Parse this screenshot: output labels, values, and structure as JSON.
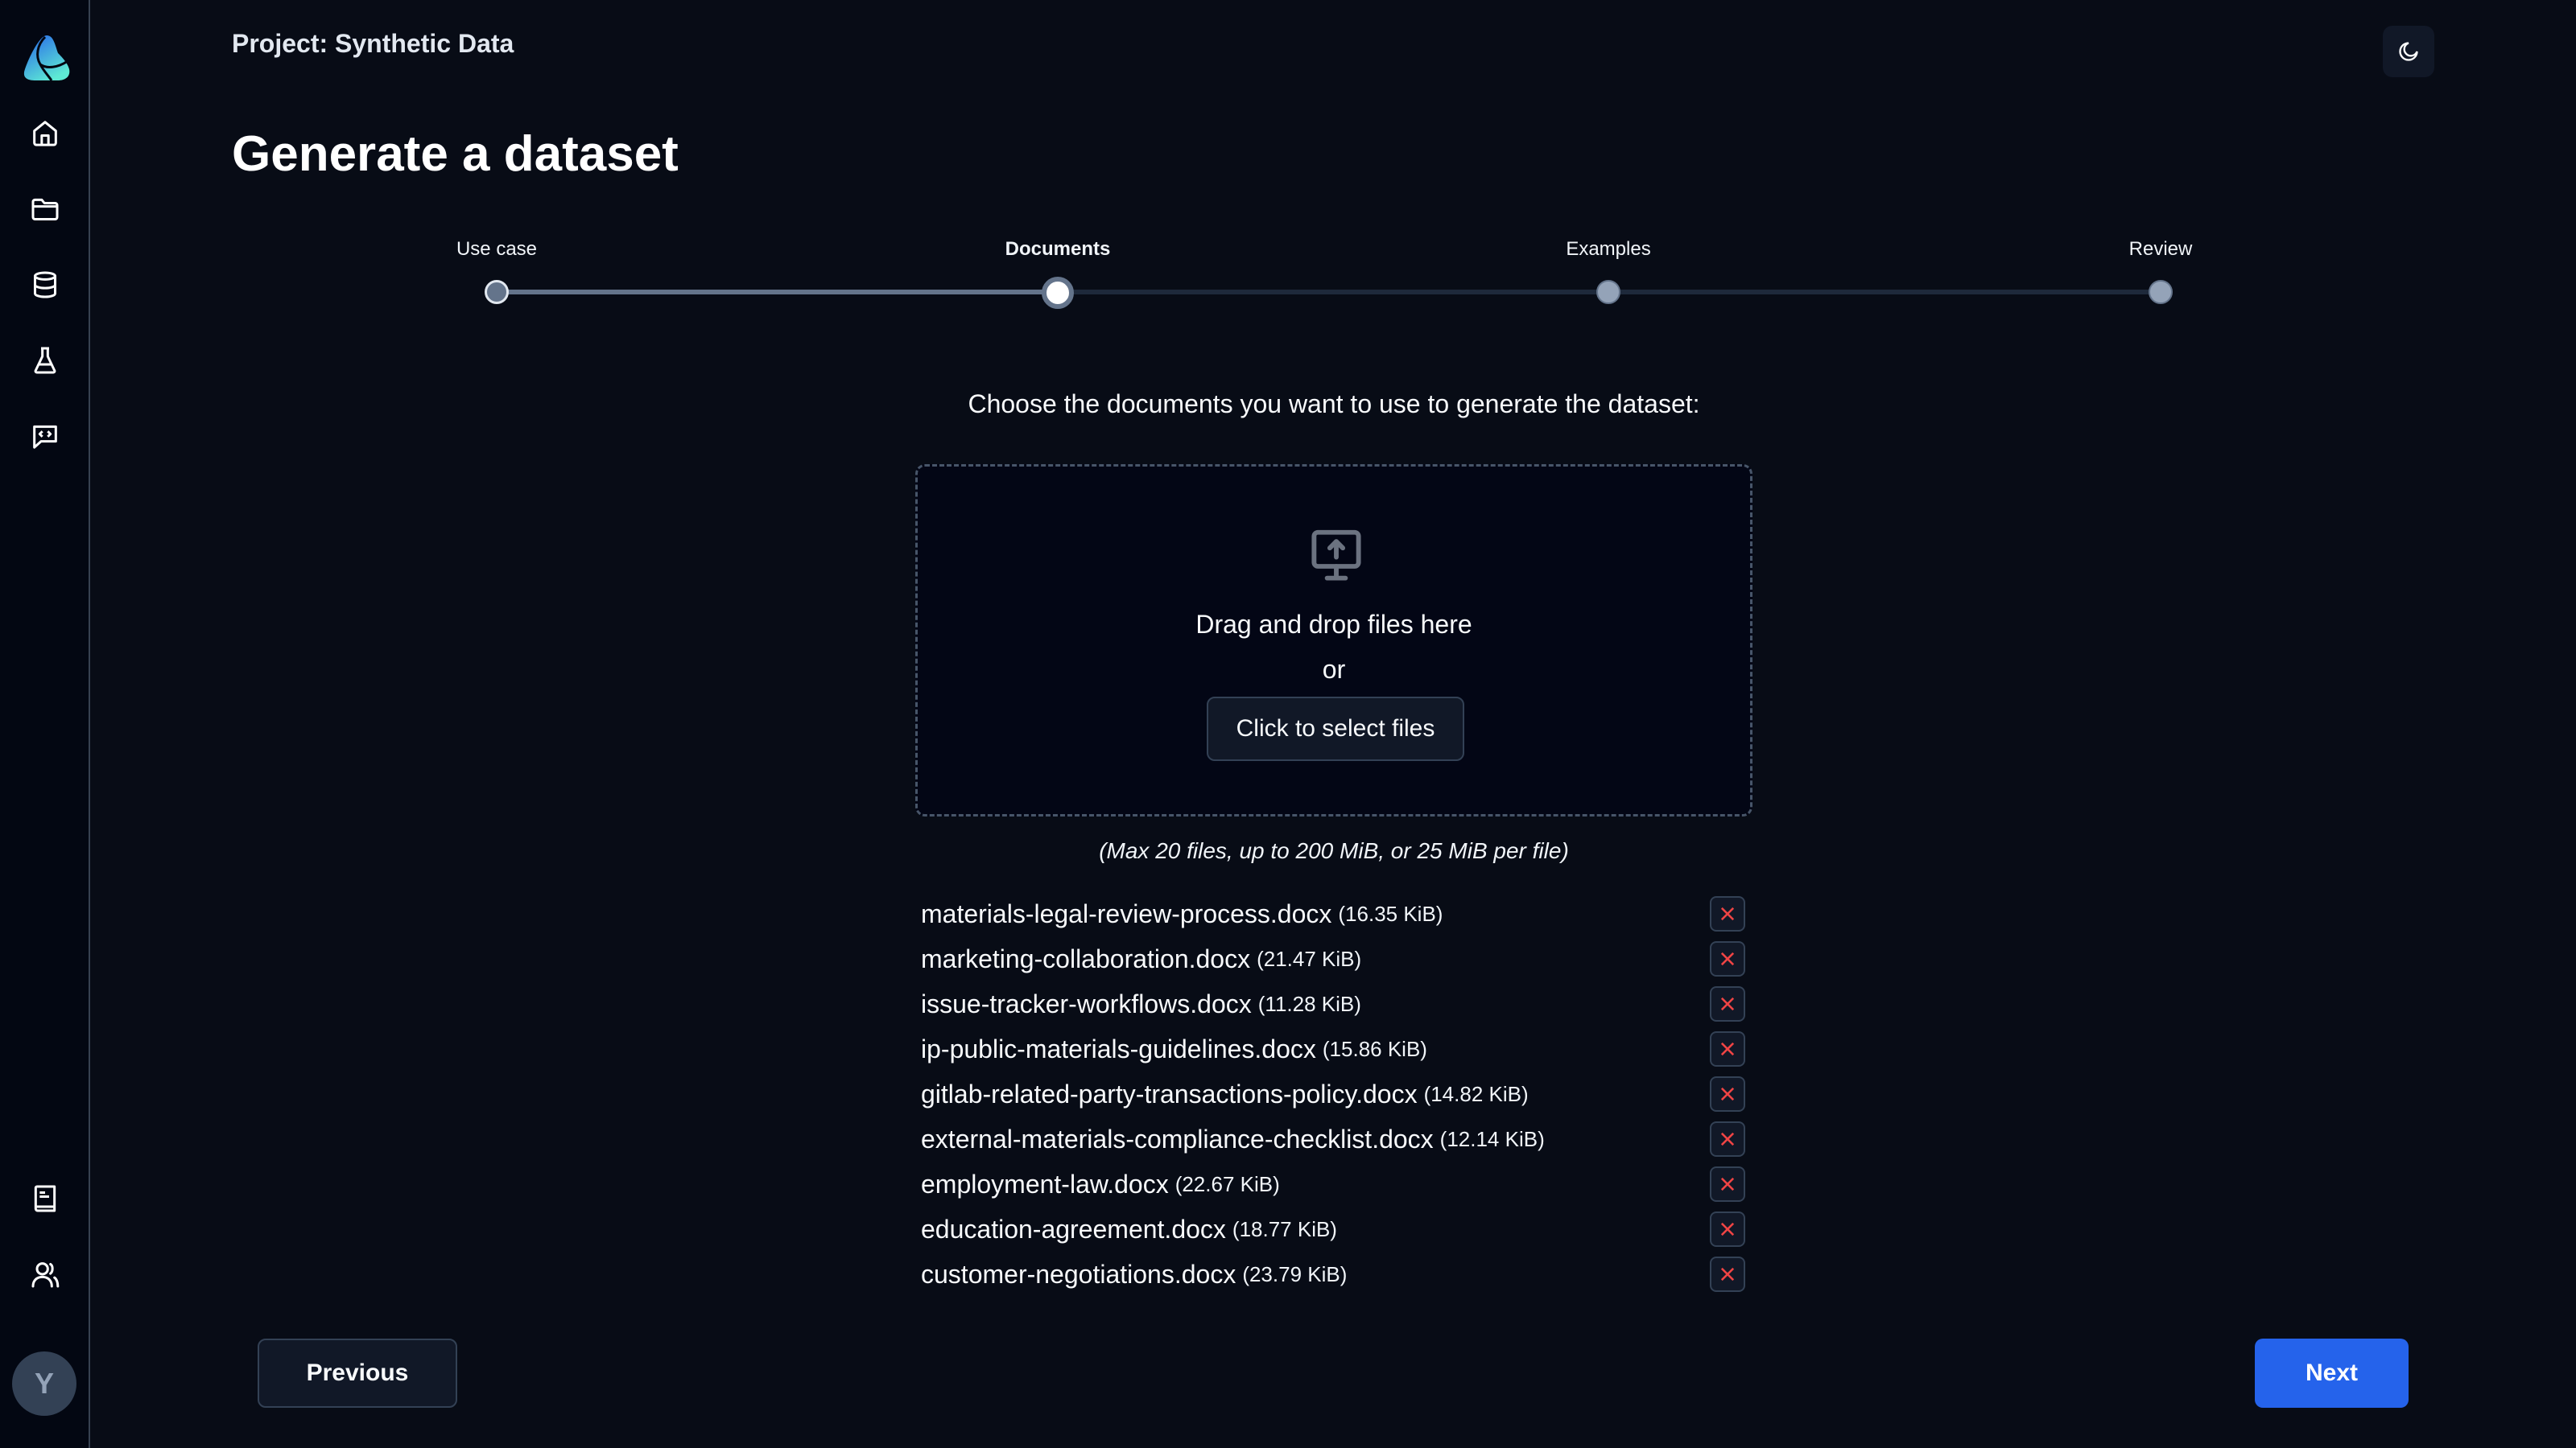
{
  "sidebar": {
    "logo": "app-logo",
    "nav_items": [
      {
        "icon": "home-icon",
        "label": "Home"
      },
      {
        "icon": "folder-icon",
        "label": "Projects"
      },
      {
        "icon": "database-icon",
        "label": "Datasets"
      },
      {
        "icon": "flask-icon",
        "label": "Experiments"
      },
      {
        "icon": "code-chat-icon",
        "label": "Prompts"
      }
    ],
    "bottom_items": [
      {
        "icon": "book-icon",
        "label": "Documentation"
      },
      {
        "icon": "users-icon",
        "label": "Users"
      }
    ],
    "avatar_initial": "Y"
  },
  "header": {
    "project_title": "Project: Synthetic Data",
    "theme_toggle_icon": "moon-icon"
  },
  "page": {
    "title": "Generate a dataset"
  },
  "stepper": {
    "current_step": 2,
    "steps": [
      {
        "label": "Use case",
        "state": "completed"
      },
      {
        "label": "Documents",
        "state": "active"
      },
      {
        "label": "Examples",
        "state": "pending"
      },
      {
        "label": "Review",
        "state": "pending"
      }
    ]
  },
  "documents": {
    "instruction": "Choose the documents you want to use to generate the dataset:",
    "dropzone": {
      "icon": "monitor-upload-icon",
      "drag_text": "Drag and drop files here",
      "or_text": "or",
      "select_button": "Click to select files"
    },
    "limits": "(Max 20 files, up to 200 MiB, or 25 MiB per file)",
    "files": [
      {
        "name": "materials-legal-review-process.docx",
        "size": "(16.35 KiB)"
      },
      {
        "name": "marketing-collaboration.docx",
        "size": "(21.47 KiB)"
      },
      {
        "name": "issue-tracker-workflows.docx",
        "size": "(11.28 KiB)"
      },
      {
        "name": "ip-public-materials-guidelines.docx",
        "size": "(15.86 KiB)"
      },
      {
        "name": "gitlab-related-party-transactions-policy.docx",
        "size": "(14.82 KiB)"
      },
      {
        "name": "external-materials-compliance-checklist.docx",
        "size": "(12.14 KiB)"
      },
      {
        "name": "employment-law.docx",
        "size": "(22.67 KiB)"
      },
      {
        "name": "education-agreement.docx",
        "size": "(18.77 KiB)"
      },
      {
        "name": "customer-negotiations.docx",
        "size": "(23.79 KiB)"
      }
    ]
  },
  "footer": {
    "previous_label": "Previous",
    "next_label": "Next"
  },
  "colors": {
    "accent": "#2563eb",
    "remove_icon": "#ef4444",
    "background": "#080c16",
    "sidebar_background": "#030712"
  }
}
